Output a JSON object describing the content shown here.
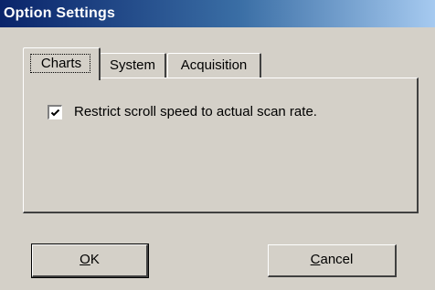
{
  "window": {
    "title": "Option Settings"
  },
  "tabs": [
    {
      "label": "Charts",
      "selected": true
    },
    {
      "label": "System",
      "selected": false
    },
    {
      "label": "Acquisition",
      "selected": false
    }
  ],
  "charts_panel": {
    "restrict_scroll": {
      "label": "Restrict scroll speed to actual scan rate.",
      "checked": true
    }
  },
  "buttons": {
    "ok": {
      "accel": "O",
      "rest": "K"
    },
    "cancel": {
      "accel": "C",
      "rest": "ancel"
    }
  },
  "colors": {
    "face": "#d4d0c8",
    "title_start": "#0a246a",
    "title_end": "#a6caf0",
    "title_text": "#ffffff"
  },
  "icons": {
    "checkbox": "check-mark-icon"
  }
}
